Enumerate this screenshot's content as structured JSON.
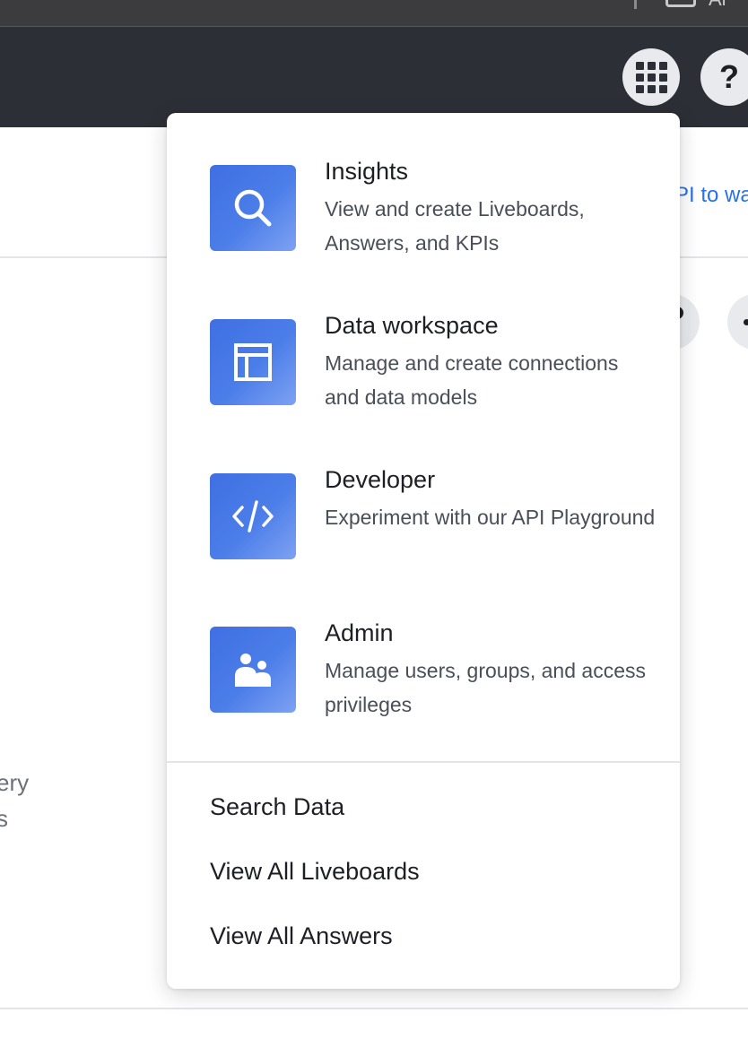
{
  "browser_chrome": {
    "partial_text": "Al"
  },
  "top_nav": {
    "apps_icon": "grid-icon",
    "help_glyph": "?"
  },
  "background": {
    "link_fragment": "PI to wa",
    "text_fragment_1": "ery",
    "text_fragment_2": "s"
  },
  "menu": {
    "items": [
      {
        "title": "Insights",
        "description": "View and create Liveboards, Answers, and KPIs",
        "icon": "search-icon"
      },
      {
        "title": "Data workspace",
        "description": "Manage and create connections and data models",
        "icon": "table-icon"
      },
      {
        "title": "Developer",
        "description": "Experiment with our API Playground",
        "icon": "code-icon"
      },
      {
        "title": "Admin",
        "description": "Manage users, groups, and access privileges",
        "icon": "users-icon"
      }
    ],
    "links": [
      {
        "label": "Search Data"
      },
      {
        "label": "View All Liveboards"
      },
      {
        "label": "View All Answers"
      }
    ]
  },
  "colors": {
    "nav_background": "#2d2f36",
    "tile_gradient_start": "#3f6fe2",
    "tile_gradient_end": "#7ea2f2",
    "link_blue": "#2770ef"
  }
}
